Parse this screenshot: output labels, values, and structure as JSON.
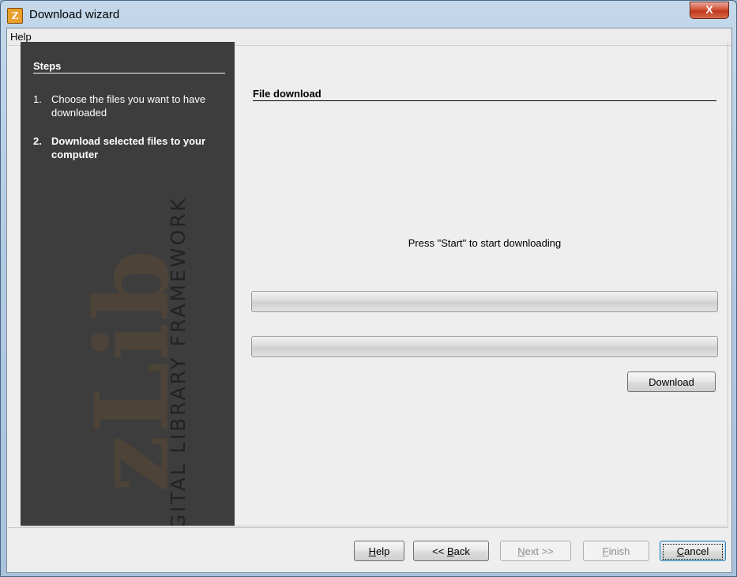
{
  "window": {
    "title": "Download wizard",
    "close_label": "X"
  },
  "menu": {
    "items": [
      "Help"
    ]
  },
  "sidebar": {
    "watermark_logo": "zLib",
    "watermark_text": "DIGITAL LIBRARY FRAMEWORK",
    "title": "Steps",
    "steps": [
      {
        "num": "1.",
        "label": "Choose the files you want to have downloaded"
      },
      {
        "num": "2.",
        "label": "Download selected files to your computer"
      }
    ]
  },
  "main": {
    "section_title": "File download",
    "status_message": "Press \"Start\" to start downloading",
    "progress": [
      0,
      0
    ],
    "download_button": "Download"
  },
  "footer": {
    "help": {
      "mnemonic": "H",
      "rest": "elp"
    },
    "back": {
      "prefix": "<< ",
      "mnemonic": "B",
      "rest": "ack"
    },
    "next": {
      "mnemonic": "N",
      "rest": "ext >>"
    },
    "finish": {
      "mnemonic": "F",
      "rest": "inish"
    },
    "cancel": {
      "mnemonic": "C",
      "rest": "ancel"
    }
  },
  "colors": {
    "sidebar_bg": "#3d3d3d",
    "title_close": "#c0381e",
    "dialog_bg": "#eeeeee"
  }
}
